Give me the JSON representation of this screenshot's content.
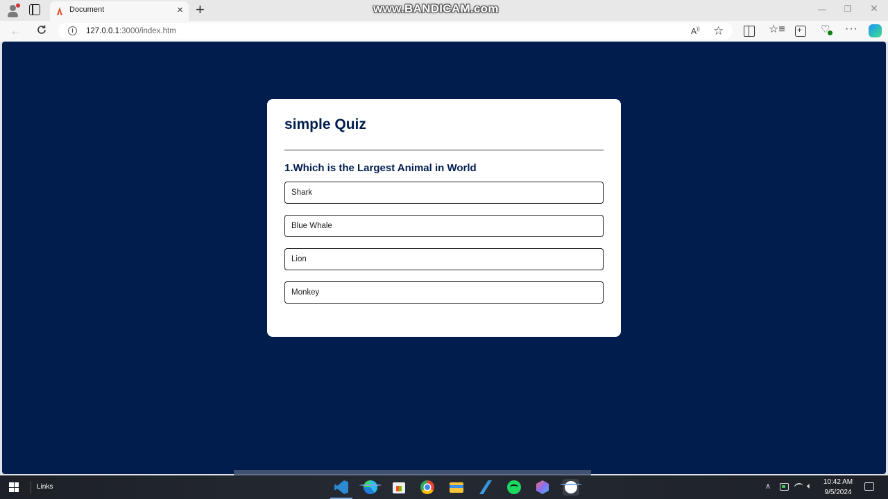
{
  "browser": {
    "tab_title": "Document",
    "tab_close": "×",
    "new_tab": "+",
    "url_host": "127.0.0.1",
    "url_path": ":3000/index.htm",
    "recording_watermark": "www.BANDICAM.com",
    "window_controls": {
      "minimize": "—",
      "maximize": "❐",
      "close": "✕"
    },
    "toolbar_icons": [
      "back-icon",
      "reload-icon",
      "site-info-icon",
      "read-aloud-icon",
      "favorite-star-icon",
      "split-screen-icon",
      "favorites-icon",
      "collections-icon",
      "browser-essentials-icon",
      "more-options-icon",
      "copilot-icon"
    ]
  },
  "page": {
    "background_color": "#001d4e",
    "quiz_title": "simple Quiz",
    "question": "1.Which is the Largest Animal in World",
    "answers": [
      {
        "label": "Shark"
      },
      {
        "label": "Blue Whale"
      },
      {
        "label": "Lion"
      },
      {
        "label": "Monkey"
      }
    ]
  },
  "taskbar": {
    "links_label": "Links",
    "apps": [
      "visual-studio-code",
      "microsoft-edge",
      "microsoft-store",
      "google-chrome",
      "file-explorer",
      "pen-app",
      "spotify",
      "cube-app",
      "bandicam"
    ],
    "clock_time": "10:42 AM",
    "clock_date": "9/5/2024"
  }
}
